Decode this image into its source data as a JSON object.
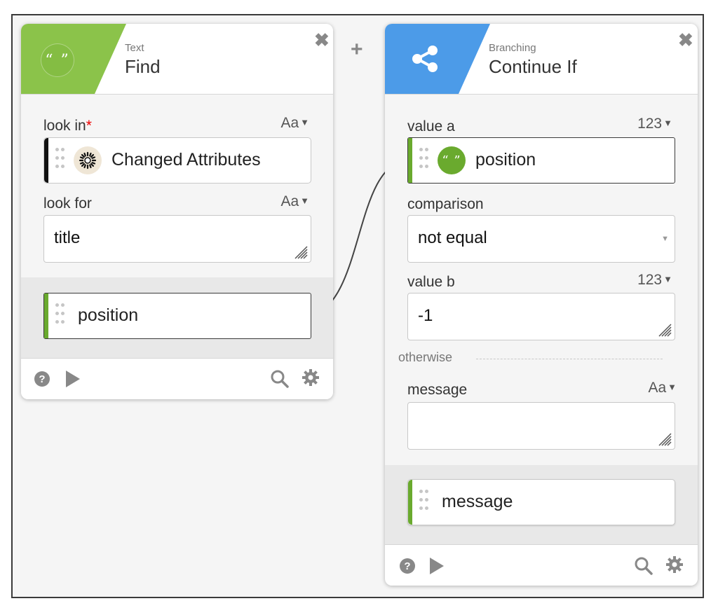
{
  "cards": {
    "find": {
      "category": "Text",
      "title": "Find",
      "close": "✖",
      "fields": {
        "look_in": {
          "label": "look in",
          "required_mark": "*",
          "type": "Aa",
          "token": {
            "label": "Changed Attributes",
            "icon": "changed-attributes-icon",
            "bar_color": "#111111"
          }
        },
        "look_for": {
          "label": "look for",
          "type": "Aa",
          "value": "title"
        }
      },
      "output": {
        "label": "position",
        "bar_color": "#6aaa2e"
      }
    },
    "continue_if": {
      "category": "Branching",
      "title": "Continue If",
      "close": "✖",
      "fields": {
        "value_a": {
          "label": "value a",
          "type": "123",
          "token": {
            "label": "position",
            "icon": "quote-icon",
            "bar_color": "#6aaa2e"
          }
        },
        "comparison": {
          "label": "comparison",
          "value": "not equal"
        },
        "value_b": {
          "label": "value b",
          "type": "123",
          "value": "-1"
        },
        "otherwise": "otherwise",
        "message": {
          "label": "message",
          "type": "Aa",
          "value": ""
        }
      },
      "output": {
        "label": "message",
        "bar_color": "#6aaa2e"
      }
    }
  },
  "add_step": "+",
  "colors": {
    "text_accent": "#8bc34a",
    "branching_accent": "#4c9be8"
  }
}
